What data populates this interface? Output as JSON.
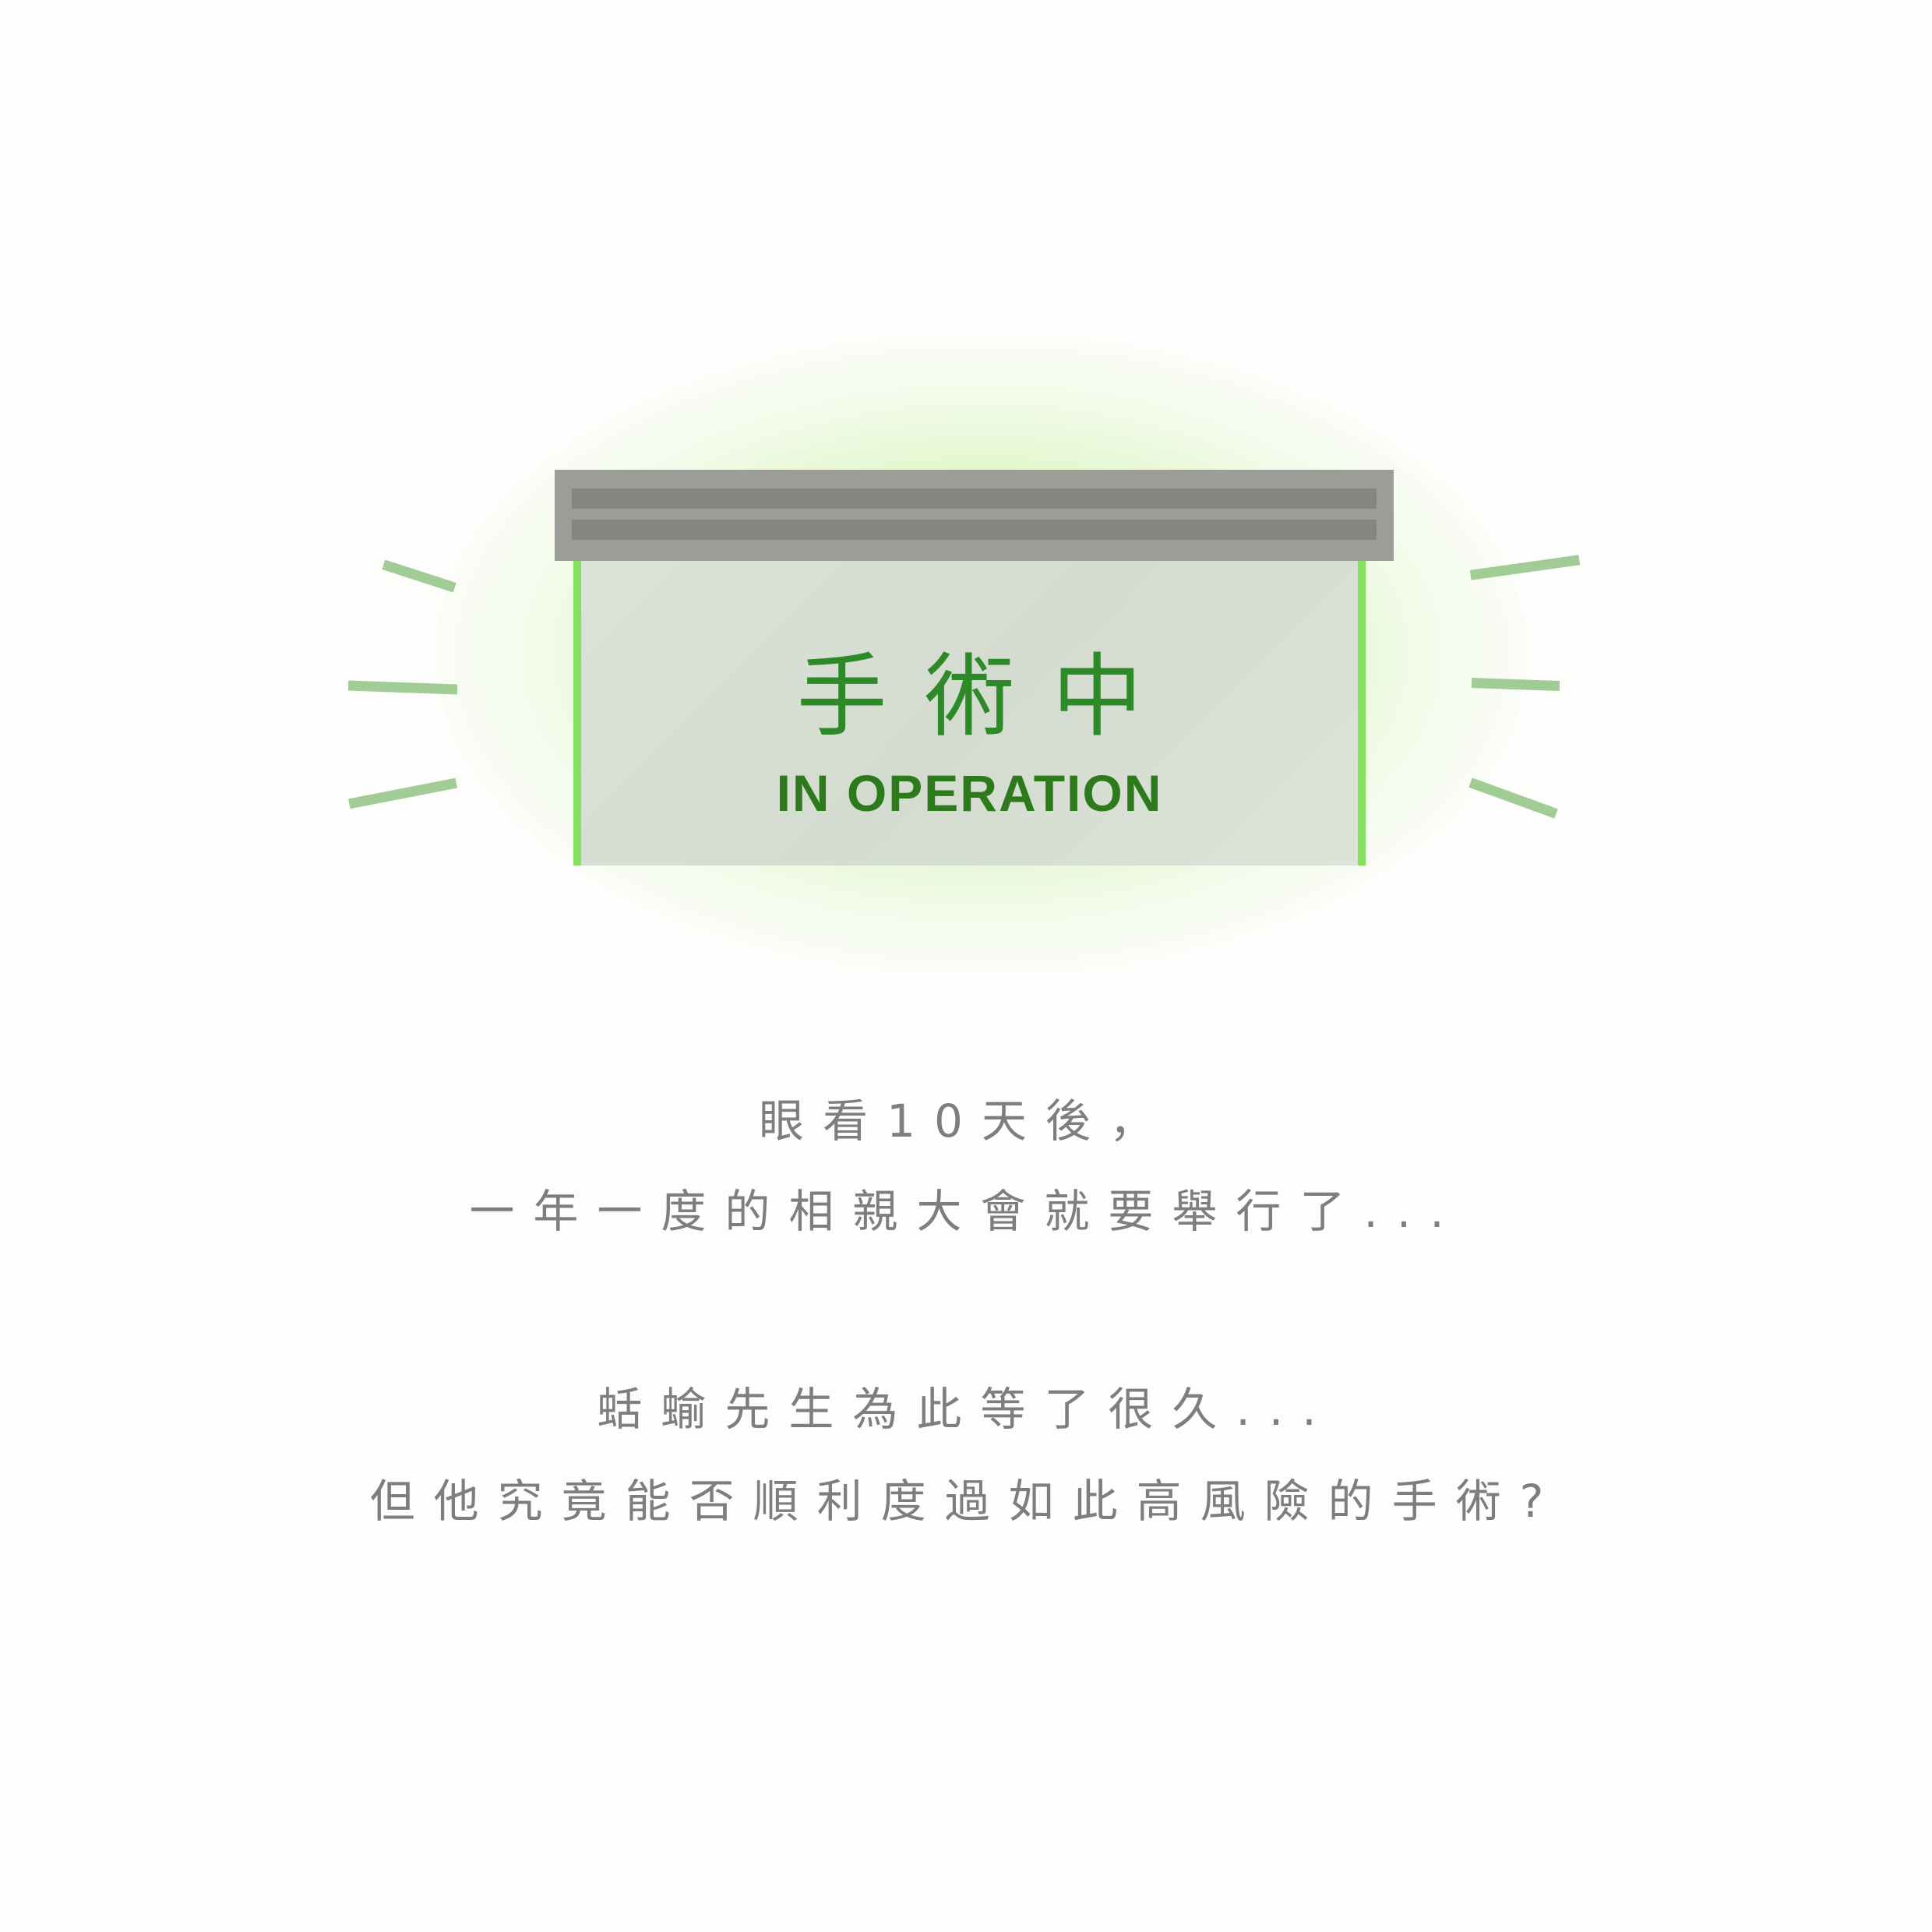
{
  "sign": {
    "chinese_label": "手術中",
    "english_label": "IN OPERATION",
    "panel_color": "#d8ded3",
    "frame_color": "#9c9c98",
    "light_color": "#86e060",
    "text_color": "#2e8a28",
    "glow_color": "#c8f0a8"
  },
  "rays": {
    "color": "#a2cc96"
  },
  "caption": {
    "line1": "眼看10天後，",
    "line2": "一年一度的相親大會就要舉行了...",
    "line3": "蛞蝓先生為此等了很久...",
    "line4": "但他究竟能否順利度過如此高風險的手術?"
  }
}
